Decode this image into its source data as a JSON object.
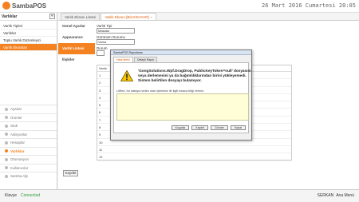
{
  "app": {
    "logo_text": "SambaPOS",
    "datetime": "26 Mart 2016 Cumartesi 20:05"
  },
  "sidebar": {
    "header": "Varlıklar",
    "collapse_symbol": "«",
    "items": [
      {
        "label": "Varlık Tipleri"
      },
      {
        "label": "Varlıklar"
      },
      {
        "label": "Toplu Varlık Düzenleyici"
      },
      {
        "label": "Varlık Ekranları"
      }
    ],
    "nav": [
      {
        "label": "Ayarlar"
      },
      {
        "label": "Ürünler"
      },
      {
        "label": "Stok"
      },
      {
        "label": "Adisyonlar"
      },
      {
        "label": "Hesaplar"
      },
      {
        "label": "Varlıklar"
      },
      {
        "label": "Otomasyon"
      },
      {
        "label": "Kullanıcılar"
      },
      {
        "label": "Samba Ağı"
      }
    ]
  },
  "tabs": [
    {
      "label": "Varlık Ekranı Listesi"
    },
    {
      "label": "Varlık Ekranı [BİLGİSAYAR]",
      "close": "×"
    }
  ],
  "sections": [
    {
      "label": "Genel Ayarlar"
    },
    {
      "label": "Appearance"
    },
    {
      "label": "Varlık Listesi"
    },
    {
      "label": "İlişkiler"
    }
  ],
  "form": {
    "type_label": "Varlık Tipi",
    "type_value": "Masalar",
    "display_label": "Görünüm Durumu",
    "display_value": "Varsa",
    "status_label": "Durum",
    "grid_header": "Varlık",
    "grid_rows": [
      "1",
      "2",
      "3",
      "4",
      "5",
      "6",
      "7",
      "8",
      "9",
      "10",
      "11",
      "12"
    ]
  },
  "save_label": "Kaydet",
  "footer": {
    "left1": "Klavye",
    "left2": "Connected",
    "user": "SERKAN",
    "menu": "Ana Menü"
  },
  "dialog": {
    "title": "SambaPOS Raporlama",
    "tab1": "Hata Metni",
    "tab2": "Detaylı Rapor",
    "message": "'GongSolutions.Wpf.DragDrop, PublicKeyToken=null' dosyasını veya derlemesini ya da bağımlılıklarından birini yükleyemedi. Sistem belirtilen dosyayı bulamıyor.",
    "prompt": "Lütfen, bu hataya neden olan işleminiz ile ilgili kısaca bilgi veriniz:",
    "buttons": [
      "Kopyala",
      "Kaydet",
      "Gönder",
      "Kapat"
    ]
  },
  "colors": {
    "accent": "#f58220",
    "connected": "#2e9e3b"
  }
}
